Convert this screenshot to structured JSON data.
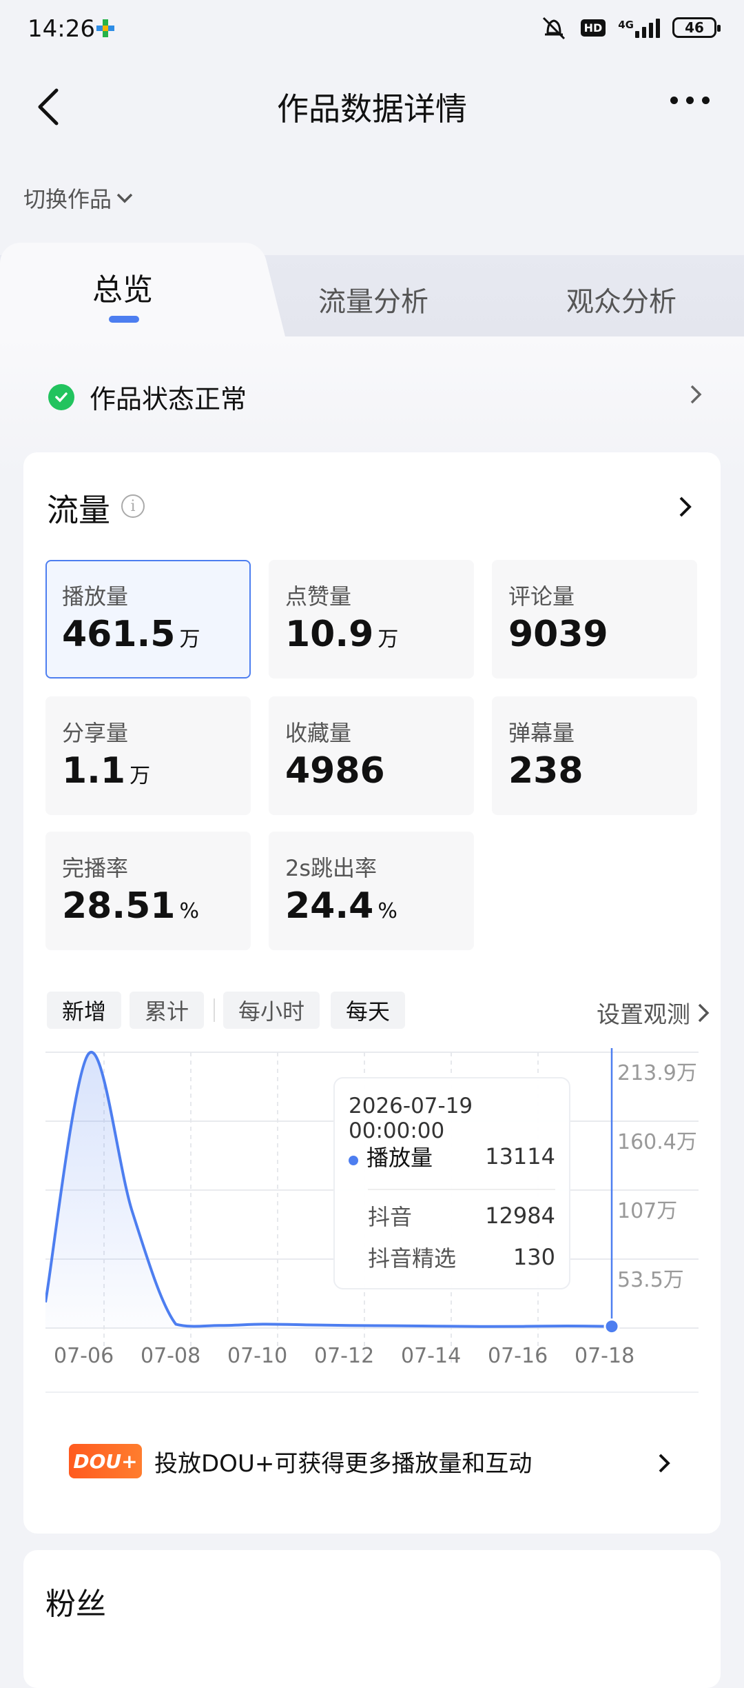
{
  "status_bar": {
    "time": "14:26",
    "network": "4G",
    "hd": "HD",
    "battery": "46"
  },
  "header": {
    "title": "作品数据详情"
  },
  "switch_work": "切换作品",
  "tabs": [
    {
      "label": "总览",
      "active": true
    },
    {
      "label": "流量分析",
      "active": false
    },
    {
      "label": "观众分析",
      "active": false
    }
  ],
  "work_status": "作品状态正常",
  "traffic": {
    "title": "流量",
    "metrics": [
      {
        "label": "播放量",
        "value": "461.5",
        "unit": "万",
        "selected": true
      },
      {
        "label": "点赞量",
        "value": "10.9",
        "unit": "万"
      },
      {
        "label": "评论量",
        "value": "9039",
        "unit": ""
      },
      {
        "label": "分享量",
        "value": "1.1",
        "unit": "万"
      },
      {
        "label": "收藏量",
        "value": "4986",
        "unit": ""
      },
      {
        "label": "弹幕量",
        "value": "238",
        "unit": ""
      },
      {
        "label": "完播率",
        "value": "28.51",
        "unit": "%"
      },
      {
        "label": "2s跳出率",
        "value": "24.4",
        "unit": "%"
      }
    ],
    "filters": {
      "mode": [
        "新增",
        "累计"
      ],
      "granularity": [
        "每小时",
        "每天"
      ],
      "active_mode": "新增",
      "active_granularity": "每天"
    },
    "settings_label": "设置观测"
  },
  "chart_data": {
    "type": "area",
    "x": [
      "07-06",
      "07-07",
      "07-08",
      "07-09",
      "07-10",
      "07-11",
      "07-12",
      "07-13",
      "07-14",
      "07-15",
      "07-16",
      "07-17",
      "07-18",
      "07-19"
    ],
    "x_tick_labels": [
      "07-06",
      "07-08",
      "07-10",
      "07-12",
      "07-14",
      "07-16",
      "07-18"
    ],
    "series": [
      {
        "name": "播放量",
        "values": [
          20,
          213,
          90,
          3,
          2,
          3,
          2.5,
          2,
          1.8,
          1.5,
          1.2,
          1.3,
          1.6,
          1.3
        ]
      }
    ],
    "y_ticks": [
      "53.5万",
      "107万",
      "160.4万",
      "213.9万"
    ],
    "ylim": [
      0,
      213.9
    ],
    "unit": "万",
    "grid": true,
    "color": "#4d7ef0",
    "tooltip": {
      "date": "2026-07-19 00:00:00",
      "items": [
        {
          "label": "播放量",
          "value": "13114",
          "primary": true
        },
        {
          "label": "抖音",
          "value": "12984"
        },
        {
          "label": "抖音精选",
          "value": "130"
        }
      ]
    }
  },
  "dou_plus": {
    "badge": "DOU+",
    "text": "投放DOU+可获得更多播放量和互动"
  },
  "fans_title": "粉丝",
  "colors": {
    "accent": "#4d7ef0",
    "ok": "#22c35e",
    "dou": "#ff6a22"
  }
}
